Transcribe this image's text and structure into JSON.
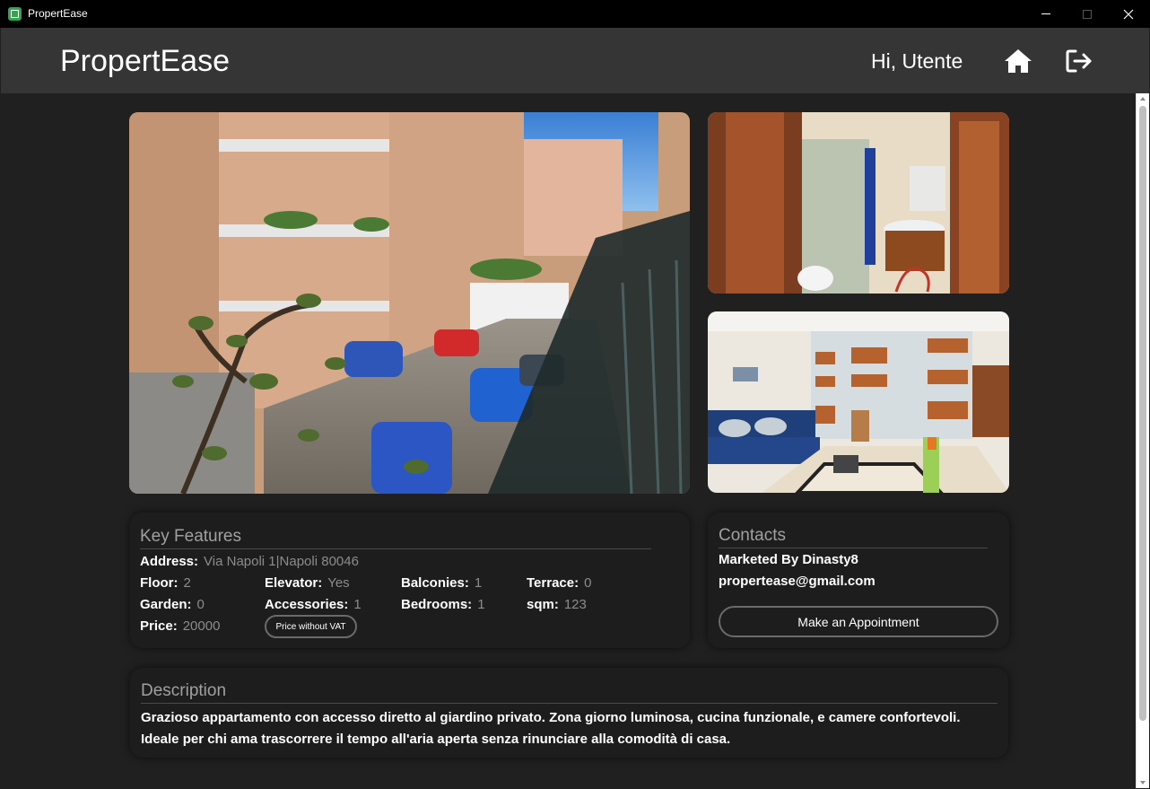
{
  "window": {
    "title": "PropertEase"
  },
  "header": {
    "brand": "PropertEase",
    "greeting": "Hi, Utente",
    "home_icon": "home-icon",
    "logout_icon": "logout-icon"
  },
  "photos": [
    {
      "name": "street-view-photo"
    },
    {
      "name": "bathroom-photo"
    },
    {
      "name": "living-room-photo"
    }
  ],
  "features": {
    "title": "Key Features",
    "address_label": "Address:",
    "address_value": "Via Napoli 1|Napoli 80046",
    "floor_label": "Floor:",
    "floor_value": "2",
    "elevator_label": "Elevator:",
    "elevator_value": "Yes",
    "balconies_label": "Balconies:",
    "balconies_value": "1",
    "terrace_label": "Terrace:",
    "terrace_value": "0",
    "garden_label": "Garden:",
    "garden_value": "0",
    "accessories_label": "Accessories:",
    "accessories_value": "1",
    "bedrooms_label": "Bedrooms:",
    "bedrooms_value": "1",
    "sqm_label": "sqm:",
    "sqm_value": "123",
    "price_label": "Price:",
    "price_value": "20000",
    "vat_button": "Price without VAT"
  },
  "contacts": {
    "title": "Contacts",
    "marketed_by": "Marketed By Dinasty8",
    "email": "propertease@gmail.com",
    "appointment_button": "Make an Appointment"
  },
  "description": {
    "title": "Description",
    "text": "Grazioso appartamento con accesso diretto al giardino privato. Zona giorno luminosa, cucina funzionale, e camere confortevoli. Ideale per chi ama trascorrere il tempo all'aria aperta senza rinunciare alla comodità di casa."
  }
}
